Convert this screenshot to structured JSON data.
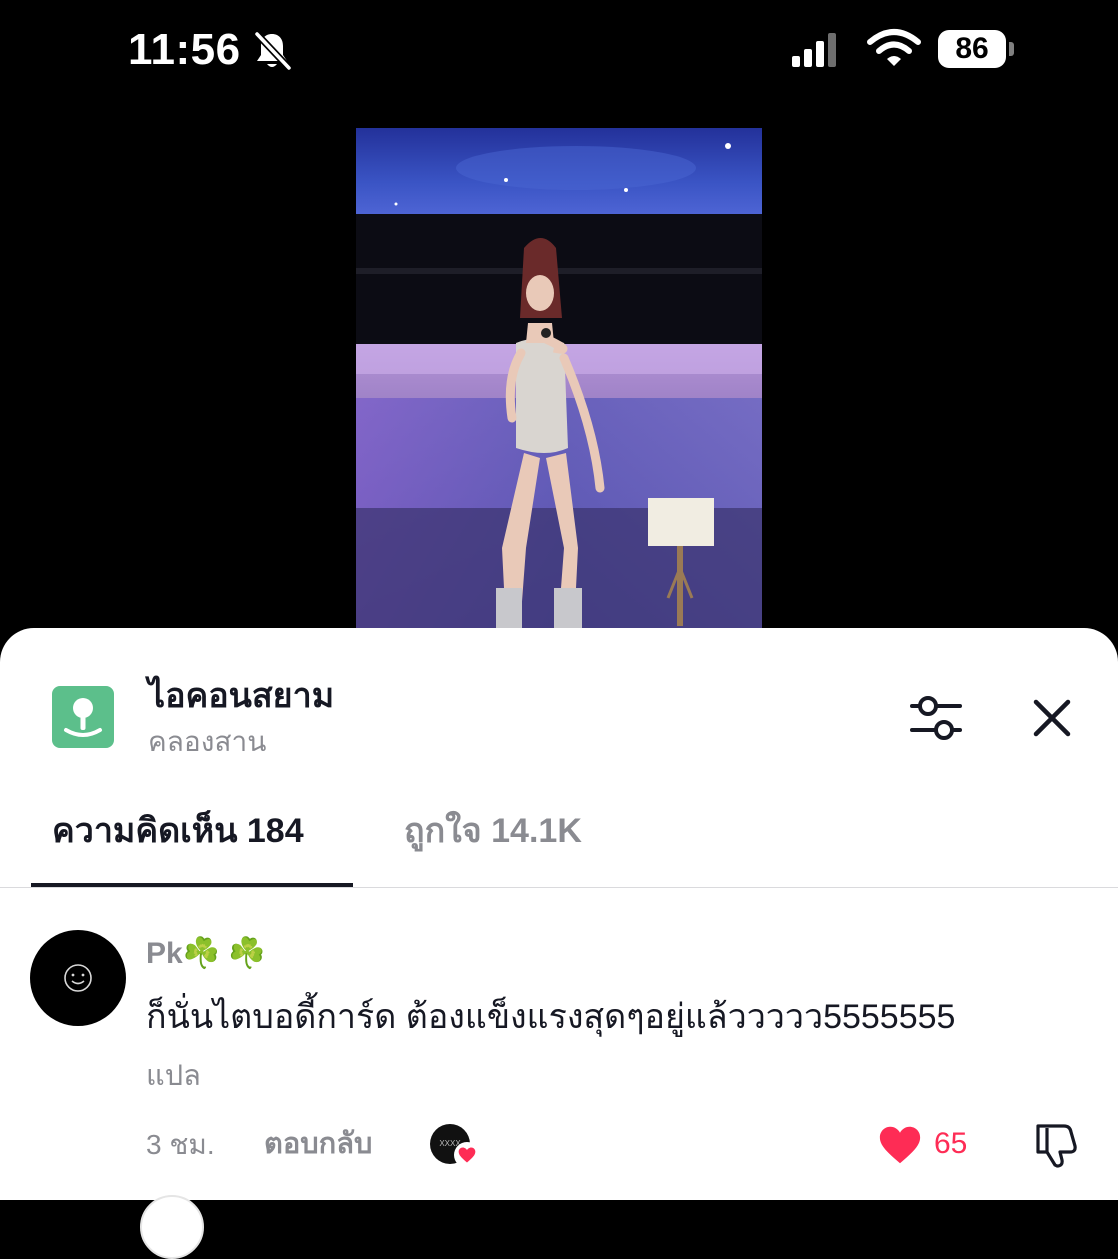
{
  "status_bar": {
    "time": "11:56",
    "battery": "86",
    "icons": [
      "bell-slash-icon",
      "cellular-signal-icon",
      "wifi-icon",
      "battery-icon"
    ]
  },
  "video": {
    "description_icon": "video-thumbnail"
  },
  "sheet": {
    "place_name": "ไอคอนสยาม",
    "place_subtitle": "คลองสาน",
    "icons": [
      "location-pin-icon",
      "sliders-icon",
      "close-icon"
    ],
    "tabs": [
      {
        "label": "ความคิดเห็น 184",
        "active": true
      },
      {
        "label": "ถูกใจ 14.1K",
        "active": false
      }
    ]
  },
  "comment": {
    "username": "Pk☘️ ☘️",
    "text": "ก็นั่นไตบอดี้การ์ด ต้องแข็งแรงสุดๆอยู่แล้ววววว5555555",
    "translate_label": "แปล",
    "time": "3 ชม.",
    "reply_label": "ตอบกลับ",
    "creator_badge_text": "XXXX",
    "like_count": "65",
    "colors": {
      "like": "#fe2c55",
      "muted": "#8a8b91",
      "primary_text": "#161823"
    }
  }
}
